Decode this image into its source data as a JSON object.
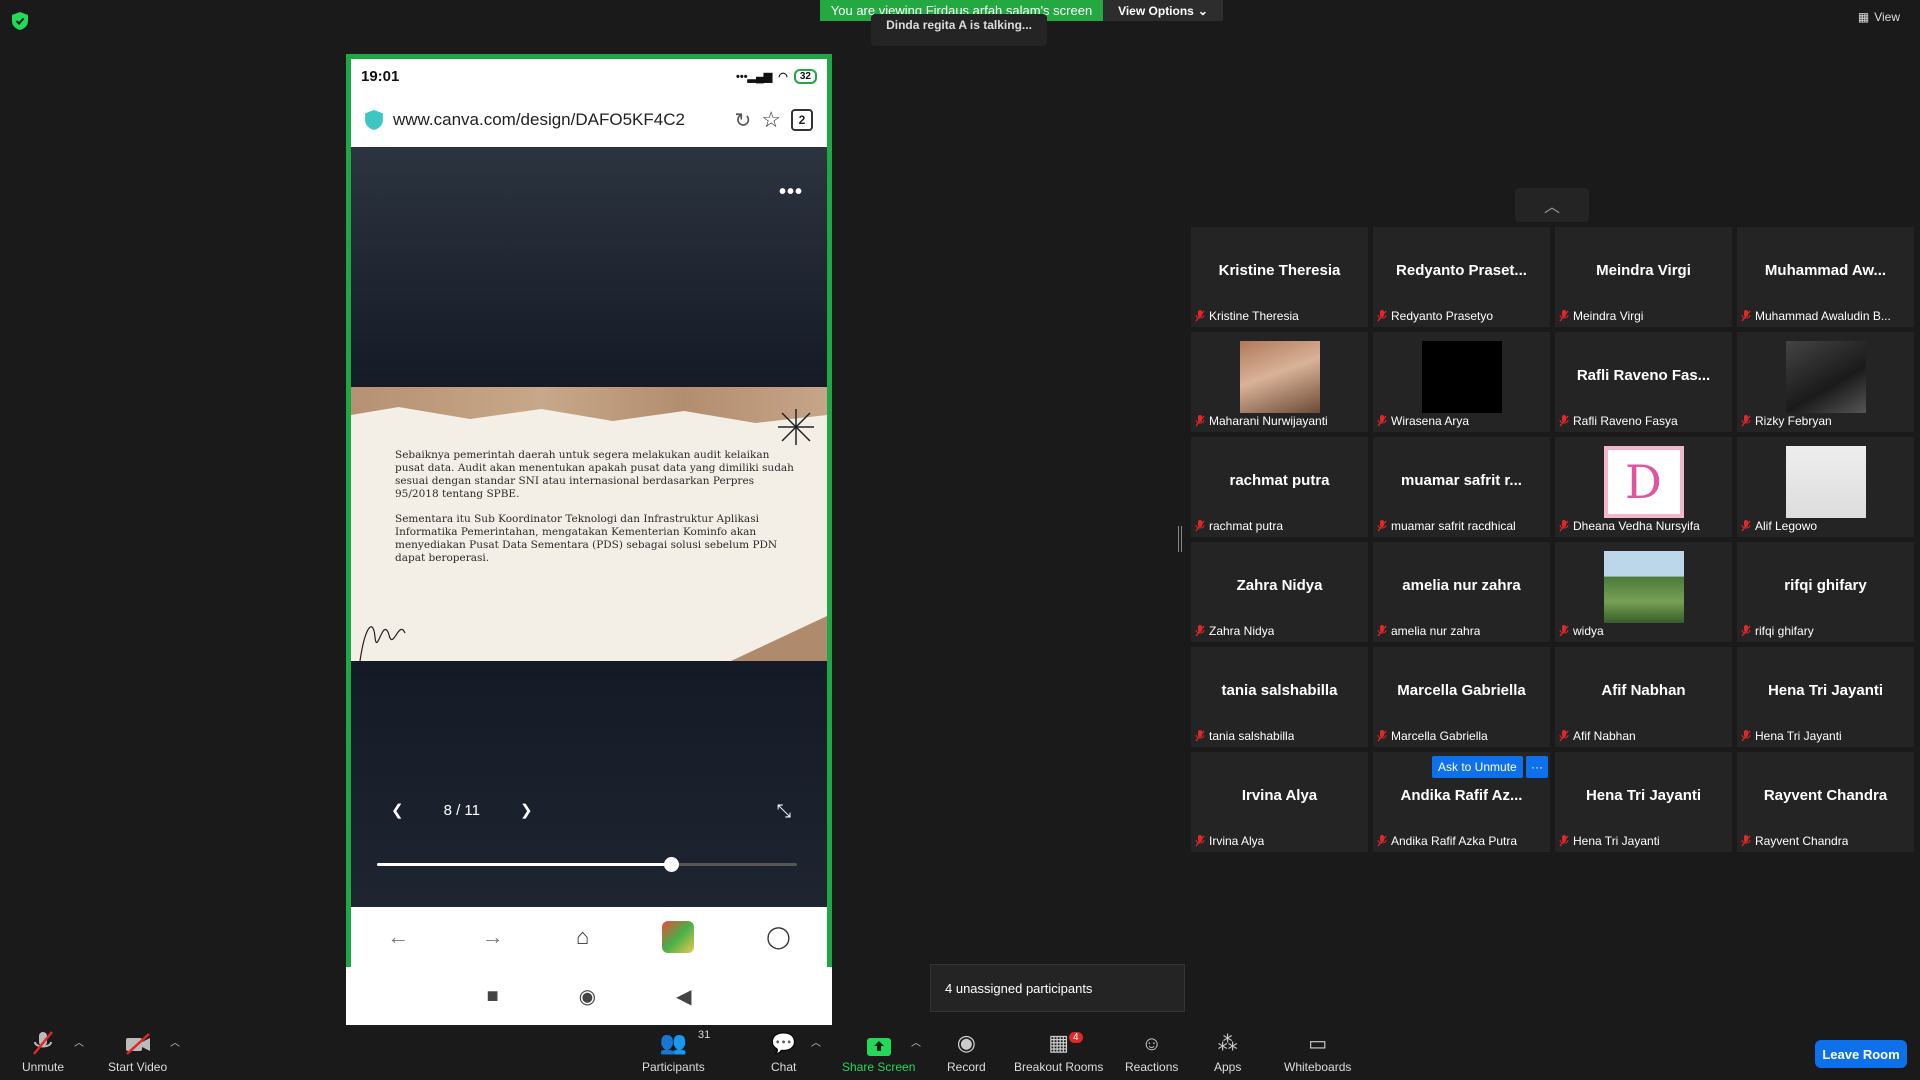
{
  "top": {
    "banner": "You are viewing Firdaus arfah salam's screen",
    "view_options": "View Options",
    "talking": "Dinda regita A is talking...",
    "view": "View"
  },
  "phone": {
    "time": "19:01",
    "battery": "32",
    "url": "www.canva.com/design/DAFO5KF4C2",
    "tab_count": "2",
    "slide_para1": "Sebaiknya pemerintah daerah untuk segera melakukan audit kelaikan pusat data. Audit akan menentukan apakah pusat data yang dimiliki sudah sesuai dengan standar SNI atau internasional berdasarkan Perpres 95/2018 tentang SPBE.",
    "slide_para2": "Sementara itu Sub Koordinator Teknologi dan Infrastruktur Aplikasi Informatika Pemerintahan, mengatakan Kementerian Kominfo akan menyediakan Pusat Data Sementara (PDS) sebagai solusi sebelum PDN dapat beroperasi.",
    "page_indicator": "8 / 11",
    "progress": 0.7
  },
  "participants": [
    {
      "name": "Kristine Theresia",
      "label": "Kristine Theresia",
      "avatar": "none"
    },
    {
      "name": "Redyanto Praset...",
      "label": "Redyanto Prasetyo",
      "avatar": "none"
    },
    {
      "name": "Meindra Virgi",
      "label": "Meindra Virgi",
      "avatar": "none"
    },
    {
      "name": "Muhammad Aw...",
      "label": "Muhammad Awaludin B...",
      "avatar": "none"
    },
    {
      "name": "",
      "label": "Maharani Nurwijayanti",
      "avatar": "face"
    },
    {
      "name": "",
      "label": "Wirasena Arya",
      "avatar": "black"
    },
    {
      "name": "Rafli Raveno Fas...",
      "label": "Rafli Raveno Fasya",
      "avatar": "none"
    },
    {
      "name": "",
      "label": "Rizky Febryan",
      "avatar": "dark"
    },
    {
      "name": "rachmat putra",
      "label": "rachmat putra",
      "avatar": "none"
    },
    {
      "name": "muamar safrit r...",
      "label": "muamar safrit racdhical",
      "avatar": "none"
    },
    {
      "name": "",
      "label": "Dheana Vedha Nursyifa",
      "avatar": "letter-d"
    },
    {
      "name": "",
      "label": "Alif Legowo",
      "avatar": "man"
    },
    {
      "name": "Zahra Nidya",
      "label": "Zahra Nidya",
      "avatar": "none"
    },
    {
      "name": "amelia nur zahra",
      "label": "amelia nur zahra",
      "avatar": "none"
    },
    {
      "name": "",
      "label": "widya",
      "avatar": "landscape"
    },
    {
      "name": "rifqi ghifary",
      "label": "rifqi ghifary",
      "avatar": "none"
    },
    {
      "name": "tania salshabilla",
      "label": "tania salshabilla",
      "avatar": "none"
    },
    {
      "name": "Marcella Gabriella",
      "label": "Marcella Gabriella",
      "avatar": "none"
    },
    {
      "name": "Afif Nabhan",
      "label": "Afif Nabhan",
      "avatar": "none"
    },
    {
      "name": "Hena Tri Jayanti",
      "label": "Hena Tri Jayanti",
      "avatar": "none"
    },
    {
      "name": "Irvina Alya",
      "label": "Irvina Alya",
      "avatar": "none"
    },
    {
      "name": "Andika Rafif Az...",
      "label": "Andika Rafif Azka Putra",
      "avatar": "none"
    },
    {
      "name": "Hena Tri Jayanti",
      "label": "Hena Tri Jayanti",
      "avatar": "none"
    },
    {
      "name": "Rayvent Chandra",
      "label": "Rayvent Chandra",
      "avatar": "none"
    }
  ],
  "ask_unmute": "Ask to Unmute",
  "ask_more": "···",
  "tooltip": "4 unassigned participants",
  "toolbar": {
    "unmute": "Unmute",
    "start_video": "Start Video",
    "participants": "Participants",
    "participants_count": "31",
    "chat": "Chat",
    "share_screen": "Share Screen",
    "record": "Record",
    "breakout_rooms": "Breakout Rooms",
    "breakout_badge": "4",
    "reactions": "Reactions",
    "apps": "Apps",
    "whiteboards": "Whiteboards",
    "leave_room": "Leave Room"
  },
  "colors": {
    "accent_green": "#23a842",
    "zoom_blue": "#0e71eb",
    "mute_red": "#e02828"
  }
}
